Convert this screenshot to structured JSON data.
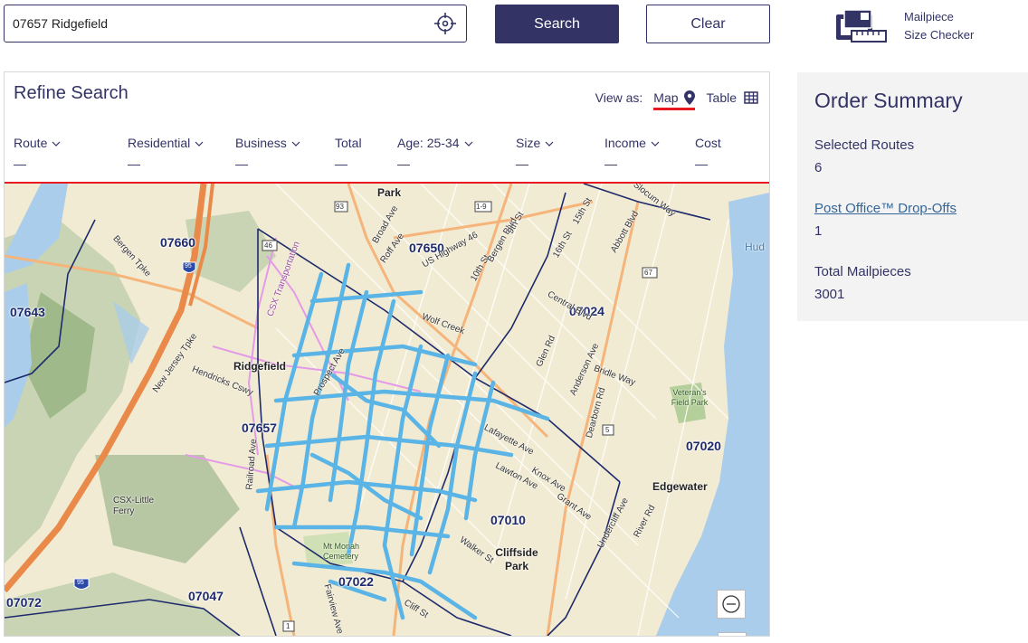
{
  "search": {
    "value": "07657 Ridgefield",
    "search_label": "Search",
    "clear_label": "Clear"
  },
  "mailpiece": {
    "line1": "Mailpiece",
    "line2": "Size Checker"
  },
  "refine": {
    "title": "Refine Search",
    "view_as_label": "View as:",
    "view_map": "Map",
    "view_table": "Table",
    "columns": [
      {
        "label": "Route",
        "value": "—"
      },
      {
        "label": "Residential",
        "value": "—"
      },
      {
        "label": "Business",
        "value": "—"
      },
      {
        "label": "Total",
        "value": "—"
      },
      {
        "label": "Age: 25-34",
        "value": "—"
      },
      {
        "label": "Size",
        "value": "—"
      },
      {
        "label": "Income",
        "value": "—"
      },
      {
        "label": "Cost",
        "value": "—"
      }
    ]
  },
  "map": {
    "zip_labels": [
      "07660",
      "07650",
      "07643",
      "07024",
      "07657",
      "07020",
      "07010",
      "07047",
      "07022",
      "07072"
    ],
    "place_labels": [
      "Park",
      "Ridgefield",
      "Edgewater",
      "Cliffside Park",
      "Veteran's Field Park",
      "CSX-Little Ferry",
      "Mt Monah Cemetery",
      "Hud"
    ],
    "street_labels": [
      "Bergen Tpke",
      "New Jersey Tpke",
      "Hendricks Cswy",
      "Broad Ave",
      "Roff Ave",
      "US Highway 46",
      "10th St",
      "Bergen Blvd",
      "9th St",
      "15th St",
      "16th St",
      "Abbott Blvd",
      "Slocum Way",
      "Central Blvd",
      "Anderson Ave",
      "Glen Rd",
      "Bridle Way",
      "Dearborn Rd",
      "Lafayette Ave",
      "Knox Ave",
      "Lawton Ave",
      "Grant Ave",
      "Undercliff Ave",
      "River Rd",
      "Railroad Ave",
      "Fairview Ave",
      "Cliff St",
      "Prospect Ave",
      "Walker St",
      "Wolf Creek",
      "CSX Transportation"
    ],
    "highway_shields": [
      "93",
      "1-9",
      "46",
      "95",
      "67",
      "5",
      "1"
    ],
    "zoom_in": "+",
    "zoom_out": "−"
  },
  "summary": {
    "title": "Order Summary",
    "routes_label": "Selected Routes",
    "routes_value": "6",
    "dropoffs_label": "Post Office™ Drop-Offs",
    "dropoffs_value": "1",
    "mailpieces_label": "Total Mailpieces",
    "mailpieces_value": "3001"
  },
  "colors": {
    "brand_navy": "#333366",
    "accent_red": "#e71921",
    "route_blue": "#5ab4e5",
    "water": "#a9cdea"
  }
}
